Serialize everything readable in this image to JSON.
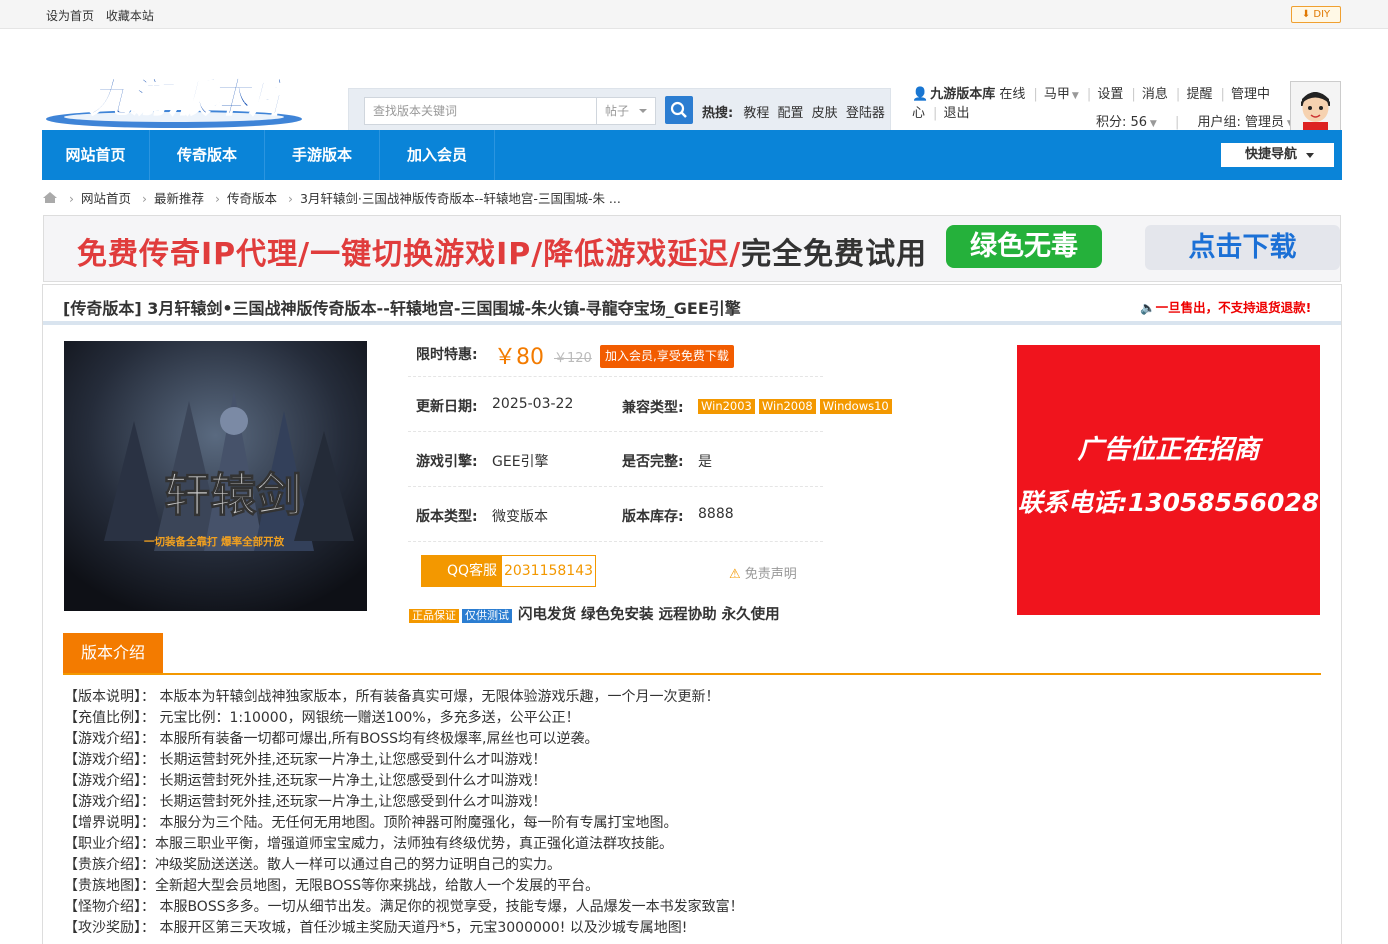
{
  "topbar": {
    "set_home": "设为首页",
    "favorite": "收藏本站",
    "diy": "DIY"
  },
  "logo": {
    "text": "九游版本库"
  },
  "search": {
    "placeholder": "查找版本关键词",
    "type": "帖子",
    "hot_label": "热搜:",
    "hot": [
      "教程",
      "配置",
      "皮肤",
      "登陆器"
    ]
  },
  "user": {
    "site": "九游版本库",
    "online": "在线",
    "name": "马甲",
    "settings": "设置",
    "messages": "消息",
    "reminders": "提醒",
    "admin": "管理中心",
    "logout": "退出",
    "points": "积分: 56",
    "group": "用户组: 管理员"
  },
  "nav": {
    "items": [
      "网站首页",
      "传奇版本",
      "手游版本",
      "加入会员"
    ],
    "quick": "快捷导航"
  },
  "breadcrumb": [
    "网站首页",
    "最新推荐",
    "传奇版本",
    "3月轩辕剑·三国战神版传奇版本--轩辕地宫-三国围城-朱 ..."
  ],
  "banner": {
    "text_red": "免费传奇IP代理/一键切换游戏IP/降低游戏延迟/",
    "text_dark": "完全免费试用",
    "green_btn": "绿色无毒",
    "download_btn": "点击下载"
  },
  "product": {
    "title": "[传奇版本] 3月轩辕剑•三国战神版传奇版本--轩辕地宫-三国围城-朱火镇-寻龍夺宝场_GEE引擎",
    "notice": "一旦售出，不支持退货退款!",
    "cover_text": "轩辕剑",
    "cover_sub": "一切装备全靠打 爆率全部开放",
    "price_label": "限时特惠:",
    "price": "￥80",
    "old_price": "￥120",
    "member_btn": "加入会员,享受免费下载",
    "update_label": "更新日期:",
    "update_date": "2025-03-22",
    "compat_label": "兼容类型:",
    "compat": [
      "Win2003",
      "Win2008",
      "Windows10"
    ],
    "engine_label": "游戏引擎:",
    "engine": "GEE引擎",
    "complete_label": "是否完整:",
    "complete": "是",
    "type_label": "版本类型:",
    "type": "微变版本",
    "stock_label": "版本库存:",
    "stock": "8888",
    "qq_label": "QQ客服",
    "qq_number": "2031158143",
    "disclaimer": "免责声明",
    "badge1": "正品保证",
    "badge2": "仅供测试",
    "features": "闪电发货 绿色免安装 远程协助 永久使用"
  },
  "ad": {
    "line1": "广告位正在招商",
    "line2": "联系电话:13058556028"
  },
  "intro": {
    "tab": "版本介绍",
    "lines": [
      "【版本说明】： 本版本为轩辕剑战神独家版本，所有装备真实可爆，无限体验游戏乐趣，一个月一次更新！",
      "【充值比例】： 元宝比例：1:10000，网银统一赠送100%，多充多送，公平公正！",
      "【游戏介绍】： 本服所有装备一切都可爆出,所有BOSS均有终极爆率,屌丝也可以逆袭。",
      "【游戏介绍】： 长期运营封死外挂,还玩家一片净土,让您感受到什么才叫游戏！",
      "【游戏介绍】： 长期运营封死外挂,还玩家一片净土,让您感受到什么才叫游戏！",
      "【游戏介绍】： 长期运营封死外挂,还玩家一片净土,让您感受到什么才叫游戏！",
      "【增界说明】： 本服分为三个陆。无任何无用地图。顶阶神器可附魔强化，每一阶有专属打宝地图。",
      "【职业介绍】：本服三职业平衡，增强道师宝宝威力，法师独有终级优势，真正强化道法群攻技能。",
      "【贵族介绍】：冲级奖励送送送。散人一样可以通过自己的努力证明自己的实力。",
      "【贵族地图】：全新超大型会员地图，无限BOSS等你来挑战，给散人一个发展的平台。",
      "【怪物介绍】： 本服BOSS多多。一切从细节出发。满足你的视觉享受，技能专爆，人品爆发一本书发家致富！",
      "【攻沙奖励】： 本服开区第三天攻城，首任沙城主奖励天道丹*5，元宝3000000! 以及沙城专属地图!"
    ]
  }
}
